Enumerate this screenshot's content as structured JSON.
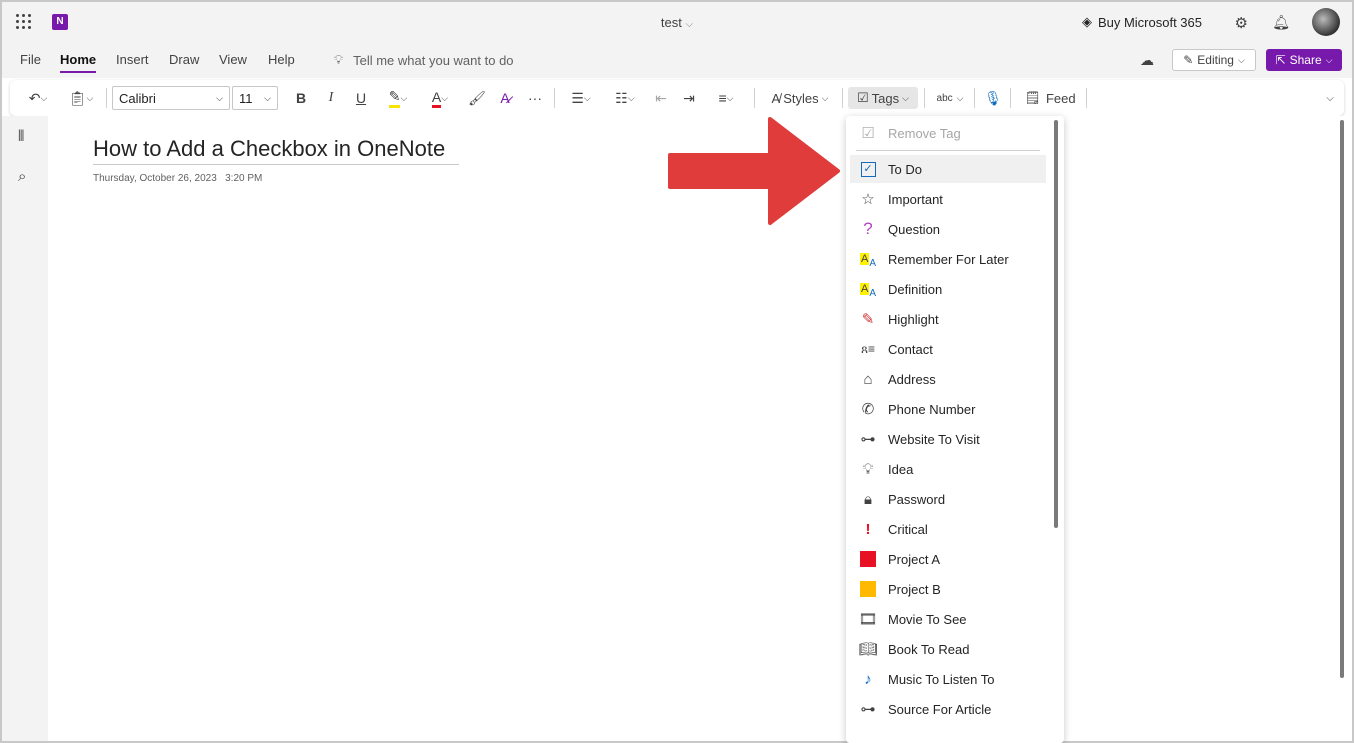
{
  "window": {
    "doc_title": "test",
    "buy_label": "Buy Microsoft 365"
  },
  "menu": {
    "tabs": [
      "File",
      "Home",
      "Insert",
      "Draw",
      "View",
      "Help"
    ],
    "tell_me": "Tell me what you want to do",
    "editing_label": "Editing",
    "share_label": "Share"
  },
  "ribbon": {
    "font_name": "Calibri",
    "font_size": "11",
    "bold": "B",
    "italic": "I",
    "underline": "U",
    "styles_label": "Styles",
    "tags_label": "Tags",
    "spell_label": "abc",
    "feed_label": "Feed"
  },
  "page": {
    "title": "How to Add a Checkbox in OneNote",
    "date": "Thursday, October 26, 2023",
    "time": "3:20 PM"
  },
  "tags_menu": {
    "items": [
      {
        "label": "Remove Tag",
        "icon": "remove-tag-icon",
        "disabled": true
      },
      {
        "label": "To Do",
        "icon": "checkbox-icon",
        "selected": true
      },
      {
        "label": "Important",
        "icon": "star-icon"
      },
      {
        "label": "Question",
        "icon": "question-icon"
      },
      {
        "label": "Remember For Later",
        "icon": "highlight-a-icon"
      },
      {
        "label": "Definition",
        "icon": "highlight-a-icon"
      },
      {
        "label": "Highlight",
        "icon": "pen-icon"
      },
      {
        "label": "Contact",
        "icon": "contact-icon"
      },
      {
        "label": "Address",
        "icon": "home-icon"
      },
      {
        "label": "Phone Number",
        "icon": "phone-icon"
      },
      {
        "label": "Website To Visit",
        "icon": "link-icon"
      },
      {
        "label": "Idea",
        "icon": "lightbulb-icon"
      },
      {
        "label": "Password",
        "icon": "lock-icon"
      },
      {
        "label": "Critical",
        "icon": "exclamation-icon"
      },
      {
        "label": "Project A",
        "icon": "red-square-icon"
      },
      {
        "label": "Project B",
        "icon": "yellow-square-icon"
      },
      {
        "label": "Movie To See",
        "icon": "film-icon"
      },
      {
        "label": "Book To Read",
        "icon": "book-icon"
      },
      {
        "label": "Music To Listen To",
        "icon": "music-note-icon"
      },
      {
        "label": "Source For Article",
        "icon": "link-icon"
      }
    ]
  },
  "colors": {
    "accent": "#7719aa",
    "arrow": "#e03c3c",
    "project_a": "#e81123",
    "project_b": "#ffb900"
  }
}
